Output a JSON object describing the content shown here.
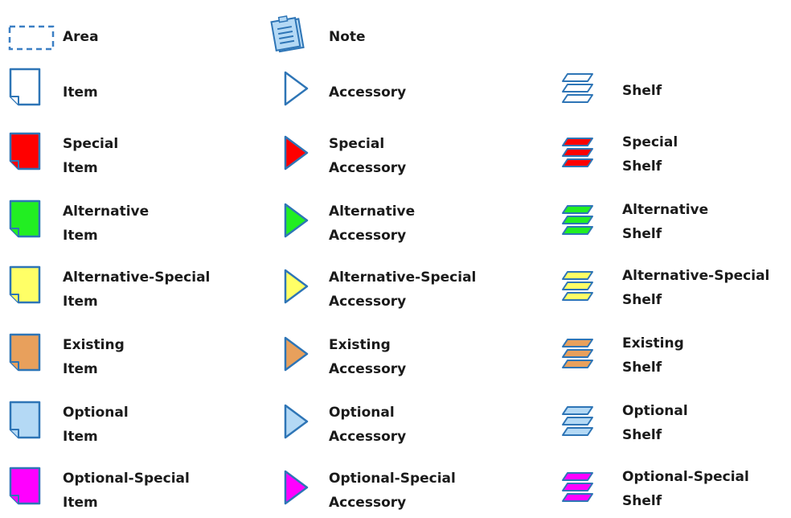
{
  "colors": {
    "outline": "#2E75B6",
    "standard": "#ffffff",
    "special": "#ff0000",
    "alternative": "#22ee22",
    "alternative_special": "#ffff66",
    "existing": "#e8a05c",
    "optional": "#b4d9f5",
    "optional_special": "#ff00ff",
    "area_border": "#3b7fc4",
    "note_fill": "#b4d9f5"
  },
  "legend": {
    "area": {
      "label": "Area",
      "icon": "dashed-area-icon"
    },
    "note": {
      "label": "Note",
      "icon": "note-icon"
    },
    "rows": [
      {
        "variant": "standard",
        "fill_color": "#ffffff",
        "item": [
          "Item"
        ],
        "accessory": [
          "Accessory"
        ],
        "shelf": [
          "Shelf"
        ]
      },
      {
        "variant": "special",
        "fill_color": "#ff0000",
        "item": [
          "Special",
          "Item"
        ],
        "accessory": [
          "Special",
          "Accessory"
        ],
        "shelf": [
          "Special",
          "Shelf"
        ]
      },
      {
        "variant": "alternative",
        "fill_color": "#22ee22",
        "item": [
          "Alternative",
          "Item"
        ],
        "accessory": [
          "Alternative",
          "Accessory"
        ],
        "shelf": [
          "Alternative",
          "Shelf"
        ]
      },
      {
        "variant": "alternative-special",
        "fill_color": "#ffff66",
        "item": [
          "Alternative-Special",
          "Item"
        ],
        "accessory": [
          "Alternative-Special",
          "Accessory"
        ],
        "shelf": [
          "Alternative-Special",
          "Shelf"
        ]
      },
      {
        "variant": "existing",
        "fill_color": "#e8a05c",
        "item": [
          "Existing",
          "Item"
        ],
        "accessory": [
          "Existing",
          "Accessory"
        ],
        "shelf": [
          "Existing",
          "Shelf"
        ]
      },
      {
        "variant": "optional",
        "fill_color": "#b4d9f5",
        "item": [
          "Optional",
          "Item"
        ],
        "accessory": [
          "Optional",
          "Accessory"
        ],
        "shelf": [
          "Optional",
          "Shelf"
        ]
      },
      {
        "variant": "optional-special",
        "fill_color": "#ff00ff",
        "item": [
          "Optional-Special",
          "Item"
        ],
        "accessory": [
          "Optional-Special",
          "Accessory"
        ],
        "shelf": [
          "Optional-Special",
          "Shelf"
        ]
      }
    ]
  }
}
